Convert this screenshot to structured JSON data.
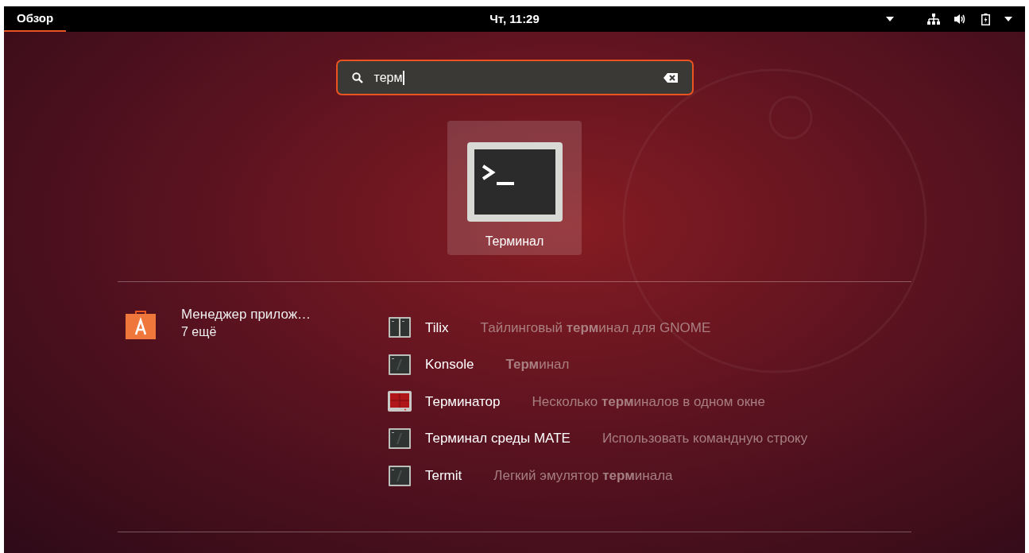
{
  "top_bar": {
    "activities": {
      "label": "Обзор",
      "selected": true
    },
    "clock": "Чт, 11:29"
  },
  "search": {
    "value": "терм"
  },
  "top_result": {
    "label": "Терминал",
    "selected": true
  },
  "provider": {
    "name": "Менеджер прилож…",
    "more": "7 ещё"
  },
  "results": [
    {
      "name": "Tilix",
      "description": "Тайлинговый **терм**инал для GNOME",
      "kind": "split"
    },
    {
      "name": "Konsole",
      "description": "**Терм**инал",
      "kind": "plain"
    },
    {
      "name": "Терминатор",
      "description": "Несколько **терм**иналов в одном окне",
      "kind": "red"
    },
    {
      "name": "Терминал среды MATE",
      "description": "Использовать командную строку",
      "kind": "plain"
    },
    {
      "name": "Termit",
      "description": "Легкий эмулятор **терм**инала",
      "kind": "plain"
    }
  ]
}
